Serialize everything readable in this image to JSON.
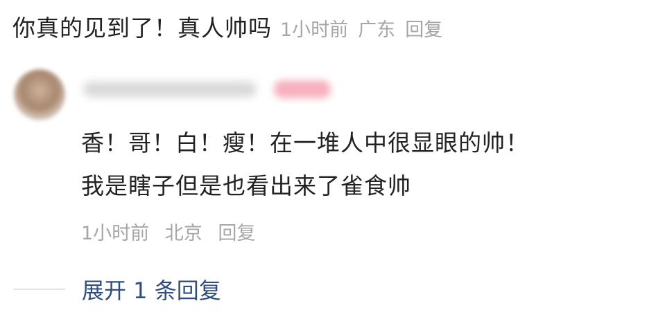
{
  "top_comment": {
    "text": "你真的见到了！真人帅吗",
    "time": "1小时前",
    "location": "广东",
    "reply_label": "回复"
  },
  "reply": {
    "lines": [
      "香！哥！白！瘦！在一堆人中很显眼的帅！",
      "我是瞎子但是也看出来了雀食帅"
    ],
    "time": "1小时前",
    "location": "北京",
    "reply_label": "回复"
  },
  "expand": {
    "label": "展开 1 条回复"
  },
  "colors": {
    "text": "#222222",
    "meta": "#a6a6a6",
    "link": "#2f4e7d"
  }
}
